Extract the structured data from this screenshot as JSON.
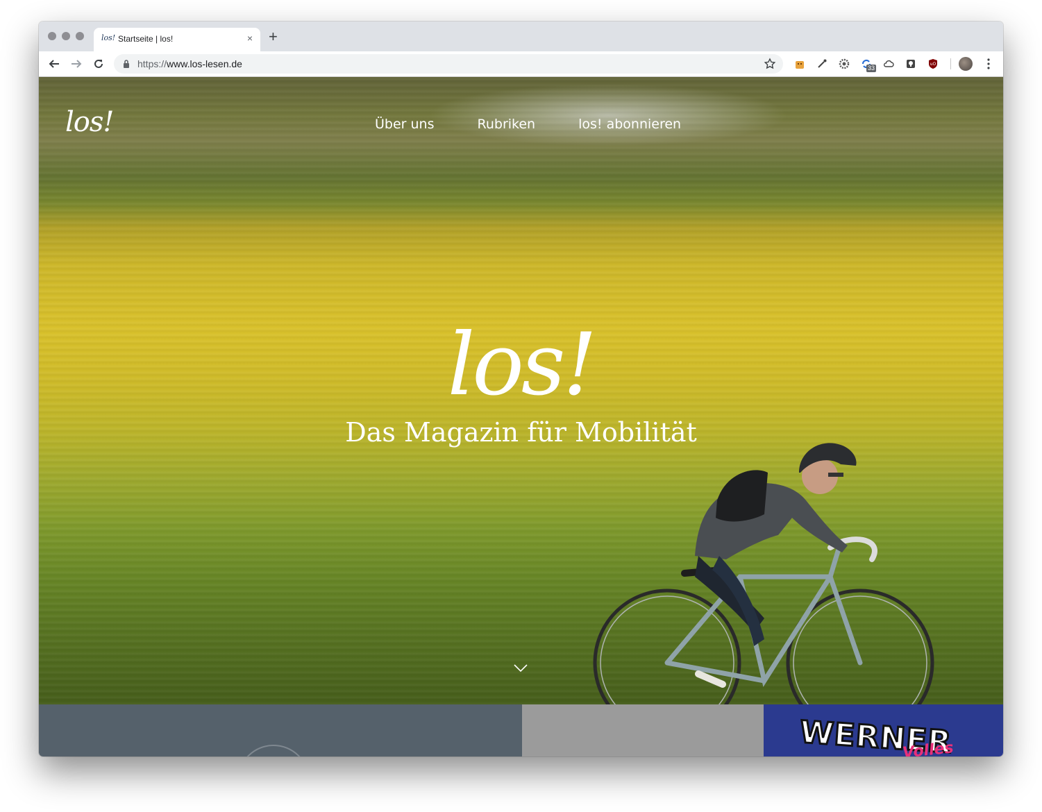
{
  "browser": {
    "tab": {
      "favicon_text": "los!",
      "title": "Startseite | los!",
      "close_glyph": "×"
    },
    "new_tab_glyph": "+",
    "address_bar": {
      "scheme": "https://",
      "host": "www.los-lesen.de"
    },
    "extension_badge": "33",
    "icons": [
      "arrow-left-icon",
      "arrow-right-icon",
      "reload-icon",
      "lock-icon",
      "star-icon",
      "kebab-menu-icon"
    ]
  },
  "site": {
    "logo": "los!",
    "nav": [
      {
        "label": "Über uns"
      },
      {
        "label": "Rubriken"
      },
      {
        "label": "los! abonnieren"
      }
    ],
    "hero": {
      "logo": "los!",
      "tagline": "Das Magazin für Mobilität"
    },
    "teasers": {
      "third_image_text": "WERNER",
      "third_image_subtext": "Volles"
    }
  },
  "colors": {
    "tabstrip": "#dee1e6",
    "hero_yellow": "#d9c12b",
    "teaser_slate": "#55616b",
    "teaser_grey": "#9b9b9b",
    "teaser_blue": "#2b3a8f"
  }
}
